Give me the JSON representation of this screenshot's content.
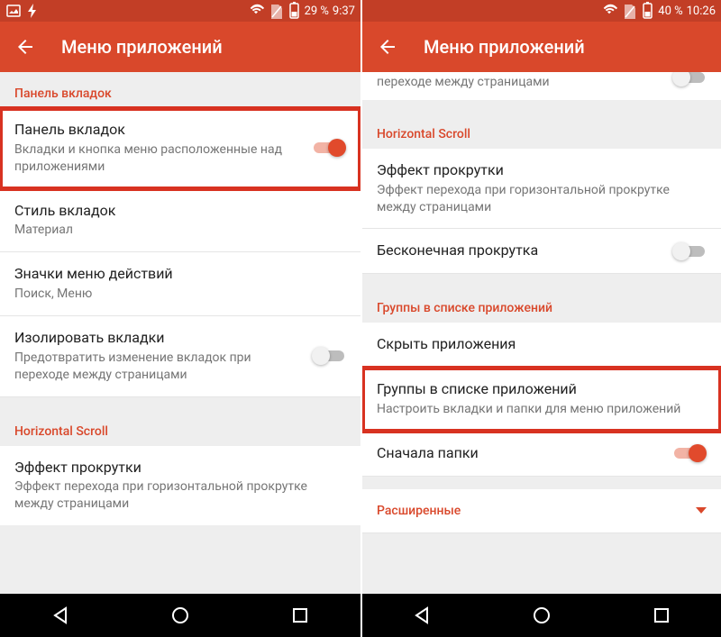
{
  "left": {
    "status": {
      "battery": "29 %",
      "time": "9:37"
    },
    "header": {
      "title": "Меню приложений"
    },
    "section1": {
      "header": "Панель вкладок"
    },
    "row_panel": {
      "title": "Панель вкладок",
      "sub": "Вкладки и кнопка меню расположенные над приложениями"
    },
    "row_style": {
      "title": "Стиль вкладок",
      "sub": "Материал"
    },
    "row_icons": {
      "title": "Значки меню действий",
      "sub": "Поиск, Меню"
    },
    "row_isolate": {
      "title": "Изолировать вкладки",
      "sub": "Предотвратить изменение вкладок при переходе между страницами"
    },
    "section2": {
      "header": "Horizontal Scroll"
    },
    "row_effect": {
      "title": "Эффект прокрутки",
      "sub": "Эффект перехода при горизонтальной прокрутке между страницами"
    }
  },
  "right": {
    "status": {
      "battery": "40 %",
      "time": "10:26"
    },
    "header": {
      "title": "Меню приложений"
    },
    "partial_top": {
      "sub": "переходе между страницами"
    },
    "section1": {
      "header": "Horizontal Scroll"
    },
    "row_effect": {
      "title": "Эффект прокрутки",
      "sub": "Эффект перехода при горизонтальной прокрутке между страницами"
    },
    "row_infinite": {
      "title": "Бесконечная прокрутка"
    },
    "section2": {
      "header": "Группы в списке приложений"
    },
    "row_hide": {
      "title": "Скрыть приложения"
    },
    "row_groups": {
      "title": "Группы в списке приложений",
      "sub": "Настроить вкладки и папки для меню приложений"
    },
    "row_folders": {
      "title": "Сначала папки"
    },
    "section3": {
      "header": "Расширенные"
    }
  }
}
